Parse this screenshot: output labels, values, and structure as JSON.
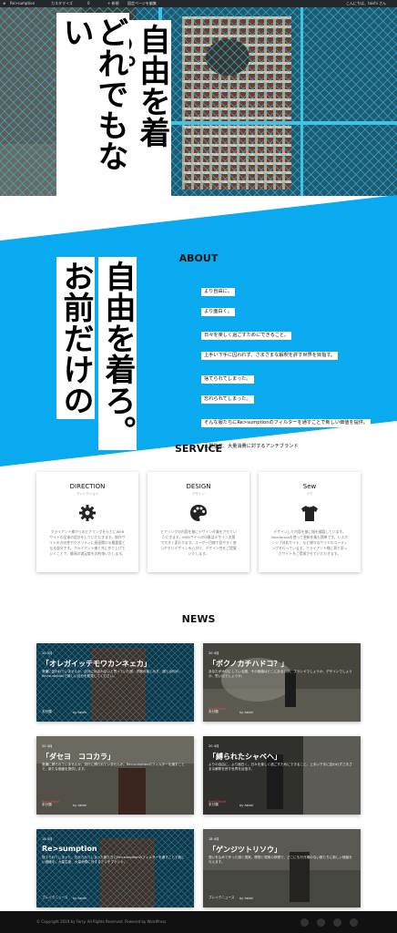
{
  "admin_bar": {
    "site": "Re>sumption",
    "customize": "カスタマイズ",
    "comments": "0",
    "new": "+ 新規",
    "edit": "固定ページを編集",
    "greeting": "こんにちは、taishi さん"
  },
  "hero": {
    "line1": "自由を着ろ。",
    "line2": "どれでもない"
  },
  "about": {
    "title": "ABOUT",
    "headline1": "自由を着ろ。",
    "headline2": "お前だけの",
    "lines": [
      "より自由に。",
      "より面白く。",
      "",
      "日々を楽しく過ごすためにできること。",
      "上手い下手に囚われず、さまざまな解釈を許す世界を目指す。",
      "",
      "捨てられてしまった。",
      "忘れられてしまった。",
      "",
      "そんな服たちにRe>sumptionのフィルターを通すことで新しい価値を提供。",
      "",
      "大量生産、大量消費に対するアンチブランド"
    ],
    "colors": {
      "accent": "#0aaaf0"
    }
  },
  "service": {
    "title": "SERVICE",
    "cards": [
      {
        "title": "DIRECTION",
        "sub": "ディレクション",
        "icon": "gear-icon",
        "desc": "クライアント様からのヒアリングをもとにWEBサイトの全体の設計をしていただきます。制作サイトの方向性やクオリティに直接関わる最重要となる部分です。クライアント様と共に作り上げていくことで、最高の満足度をお約束いたします。"
      },
      {
        "title": "DESIGN",
        "sub": "デザイン",
        "icon": "palette-icon",
        "desc": "ヒアリングの内容を基にデザイン作業をさせていただきます。WEBサイトの印象はデザイン次第で大きく変わります。ユーザー目線で見やすく使いやすいデザインを心がけ、デザイン性をご提案いたします。"
      },
      {
        "title": "Sew",
        "sub": "ソウ",
        "icon": "tshirt-icon",
        "desc": "デザインした内容を基に服を縫製しています。Wordpressを使って更新作業も簡単です。レスポンシブ対応サイト、など様々なサイトのコーディングを行っています。クライアント様に寄り添ったサイトをご提案させていただきます。"
      }
    ]
  },
  "news": {
    "title": "NEWS",
    "items": [
      {
        "date": "20 4月",
        "title": "「オレガイッテモワカンネェカ」",
        "excerpt": "常識に囚われていませんか。自分に似合わないと思っていた服、洋服の楽しみ方、服とは何か。Re>sumptionで新しい自分を発見してください。",
        "category": "未分類",
        "author": "by taishi",
        "tag": ""
      },
      {
        "date": "20 4月",
        "title": "「ボクノカチハドコ？」",
        "excerpt": "あなたが大切にしている服、その価値はどこにあるのか。ブランドでしょうか、デザインでしょうか、思い出でしょうか。",
        "category": "未分類",
        "author": "by taishi",
        "tag": "Read More"
      },
      {
        "date": "20 4月",
        "title": "「ダセヨ　ココカラ」",
        "excerpt": "常識に縛られていませんか。流行に縛られていませんか。Re>sumptionのフィルターを通すことで、新たな価値を提供します。",
        "category": "未分類",
        "author": "by taishi",
        "tag": "Read More"
      },
      {
        "date": "20 4月",
        "title": "「縛られたシャベヘ」",
        "excerpt": "よりの自由に。より面白く。日々を楽しく過ごすためにできること。上手い下手に囚われずさまざまな解釈を許す世界を目指す。",
        "category": "未分類",
        "author": "by taishi",
        "tag": "Read More"
      },
      {
        "date": "18 4月",
        "title": "Re>sumption",
        "excerpt": "捨てられてしまった、忘れられてしまった服たちにRe>sumptionのフィルターを通すことで新しい価値を。大量生産、大量消費に対するアンチブランド。",
        "category": "ブレイクニュース",
        "author": "by taishi",
        "tag": ""
      },
      {
        "date": "18 4月",
        "title": "「ゲンジツトリソウ」",
        "excerpt": "想いを込めて作った服と現実。理想と現実の狭間で、どこにも行き場のない服たちに新しい価値を与えます。",
        "category": "ブレイクニュース",
        "author": "by taishi",
        "tag": ""
      }
    ]
  },
  "footer": {
    "copyright": "© Copyright 2019 by Ferry. All Rights Reserved. Powered by WordPress"
  }
}
